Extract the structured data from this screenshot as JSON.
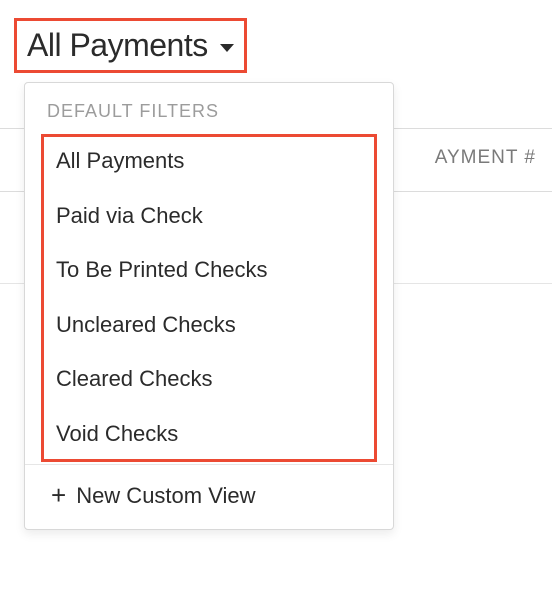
{
  "dropdown": {
    "trigger_label": "All Payments",
    "section_header": "DEFAULT FILTERS",
    "items": [
      "All Payments",
      "Paid via Check",
      "To Be Printed Checks",
      "Uncleared Checks",
      "Cleared Checks",
      "Void Checks"
    ],
    "new_view_label": "New Custom View"
  },
  "table": {
    "col_payment": "AYMENT #"
  }
}
